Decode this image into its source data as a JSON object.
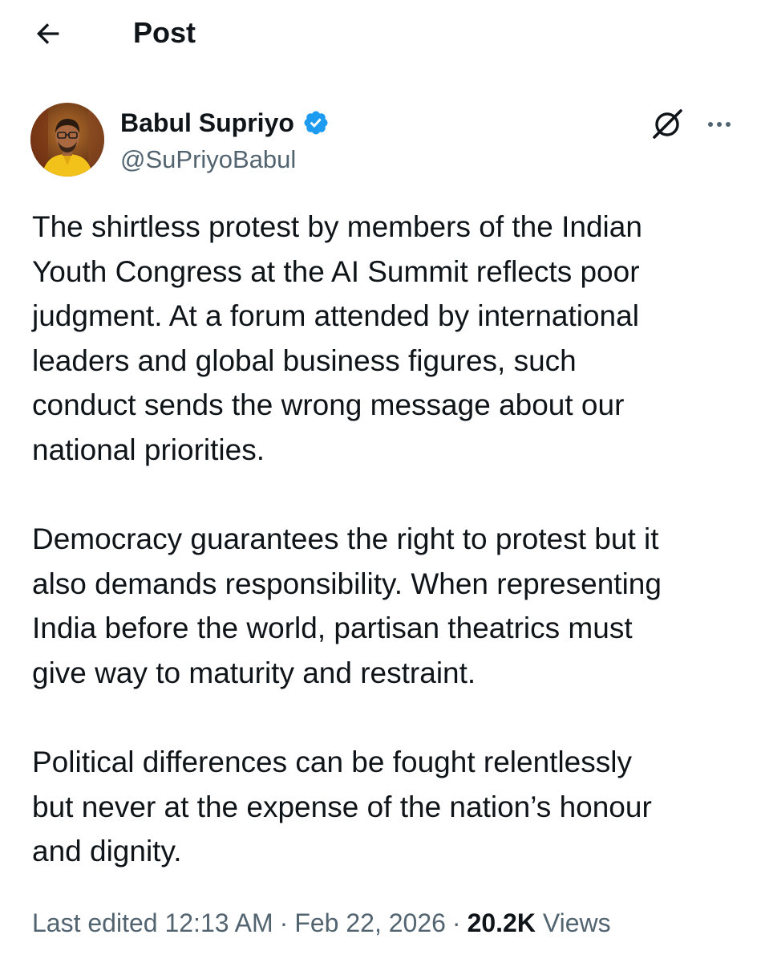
{
  "header": {
    "title": "Post"
  },
  "author": {
    "name": "Babul Supriyo",
    "handle": "@SuPriyoBabul",
    "verified": true
  },
  "post": {
    "paragraphs": [
      "The shirtless protest by members of the Indian\nYouth Congress at the AI Summit reflects poor\njudgment. At a forum attended by international\nleaders and global business figures, such\nconduct sends the wrong message about our\nnational priorities.",
      "Democracy guarantees the right to protest but it\nalso demands responsibility. When representing\nIndia before the world, partisan theatrics must\ngive way to maturity and restraint.",
      "Political differences can be fought relentlessly\nbut never at the expense of the nation’s honour\nand dignity."
    ]
  },
  "meta": {
    "edited_label": "Last edited 12:13 AM",
    "separator": "·",
    "date": "Feb 22, 2026",
    "views_count": "20.2K",
    "views_label": "Views"
  },
  "icons": {
    "back": "arrow-left-icon",
    "verified": "verified-badge-icon",
    "grok": "grok-icon",
    "more": "more-horizontal-icon"
  },
  "colors": {
    "text_primary": "#0f1419",
    "text_secondary": "#536471",
    "verified_blue": "#1d9bf0",
    "background": "#ffffff"
  }
}
